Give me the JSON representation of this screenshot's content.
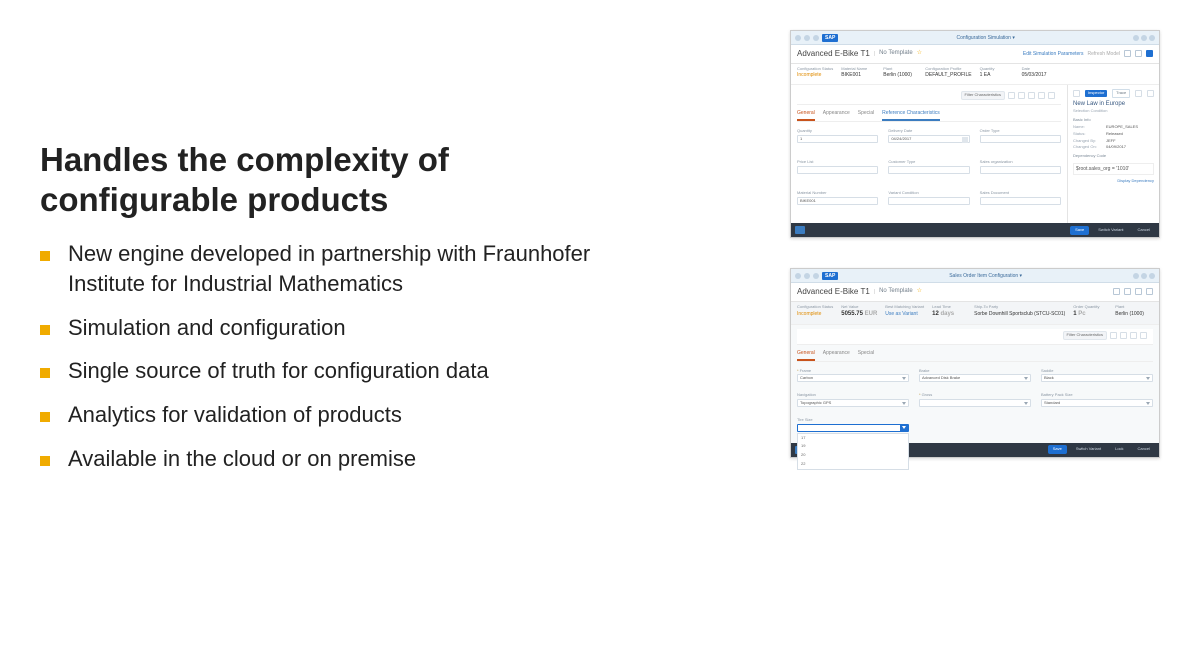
{
  "heading": "Handles the complexity of configurable products",
  "bullets": [
    "New engine developed in partnership with Fraunhofer Institute for Industrial Mathematics",
    "Simulation and configuration",
    "Single source of truth for configuration data",
    "Analytics for validation of products",
    "Available in the cloud or on premise"
  ],
  "mock1": {
    "sap": "SAP",
    "app_title": "Configuration Simulation ▾",
    "product": "Advanced E-Bike T1",
    "subtitle": "No Template",
    "edit_link": "Edit Simulation Parameters",
    "refresh": "Refresh Model",
    "meta": {
      "cfg_status_lbl": "Configuration Status",
      "cfg_status_val": "Incomplete",
      "mat_name_lbl": "Material Name",
      "mat_name_val": "BIKE001",
      "plant_lbl": "Plant",
      "plant_val": "Berlin (1000)",
      "profile_lbl": "Configuration Profile",
      "profile_val": "DEFAULT_PROFILE",
      "qty_lbl": "Quantity",
      "qty_val": "1 EA",
      "date_lbl": "Date",
      "date_val": "05/03/2017"
    },
    "filter_chip": "Filter Characteristics",
    "tabs": {
      "general": "General",
      "appearance": "Appearance",
      "special": "Special",
      "ref": "Reference Characteristics"
    },
    "fields": {
      "quantity": "Quantity",
      "quantity_v": "1",
      "deliv": "Delivery Date",
      "deliv_v": "04/24/2017",
      "otype": "Order Type",
      "plist": "Price List",
      "ctype": "Customer Type",
      "sorg": "Sales organization",
      "matno": "Material Number",
      "matno_v": "BIKE001",
      "vcond": "Variant Condition",
      "sdoc": "Sales Document"
    },
    "side": {
      "inspector": "Inspector",
      "trace": "Trace",
      "title": "New Law in Europe",
      "subtitle": "Selection Condition",
      "basic": "Basic Info",
      "name_l": "Name:",
      "name_v": "EUROPE_SALES",
      "status_l": "Status:",
      "status_v": "Released",
      "chby_l": "Changed By:",
      "chby_v": "JEFF",
      "chon_l": "Changed On:",
      "chon_v": "04/09/2017",
      "dep": "Dependency Code",
      "dep_v": "$root.sales_org = '1010'",
      "link": "Display Dependency"
    },
    "footer": {
      "save": "Save",
      "switch": "Switch Variant",
      "cancel": "Cancel"
    }
  },
  "mock2": {
    "sap": "SAP",
    "app_title": "Sales Order Item Configuration ▾",
    "product": "Advanced E-Bike T1",
    "subtitle": "No Template",
    "meta": {
      "cfg_status_lbl": "Configuration Status",
      "cfg_status_val": "Incomplete",
      "net_lbl": "Net Value",
      "net_val": "5055.75 ",
      "net_cur": "EUR",
      "match_lbl": "Best Matching Variant",
      "match_link": "Use as Variant",
      "lead_lbl": "Lead Time",
      "lead_val": "12 ",
      "lead_u": "days",
      "ship_lbl": "Ship-To Party",
      "ship_val": "Sorbe Downhill Sportsclub (STCU-SC01)",
      "oq_lbl": "Order Quantity",
      "oq_val": "1 ",
      "oq_u": "Pc",
      "plant_lbl": "Plant",
      "plant_val": "Berlin (1000)"
    },
    "filter_chip": "Filter Characteristics",
    "tabs": {
      "general": "General",
      "appearance": "Appearance",
      "special": "Special"
    },
    "fields": {
      "frame": "Frame",
      "frame_v": "Carbon",
      "brake": "Brake",
      "brake_v": "Advanced Disk Brake",
      "saddle": "Saddle",
      "saddle_v": "Black",
      "nav": "Navigation",
      "nav_v": "Topographic GPS",
      "gross": "Gross",
      "gross_v": "",
      "batt": "Battery Pack Size",
      "batt_v": "Standard",
      "tire": "Tire Size",
      "tire_v": "",
      "opts": [
        "17",
        "19",
        "20",
        "22"
      ]
    },
    "footer": {
      "save": "Save",
      "switch": "Switch Variant",
      "lock": "Lock",
      "cancel": "Cancel"
    }
  }
}
